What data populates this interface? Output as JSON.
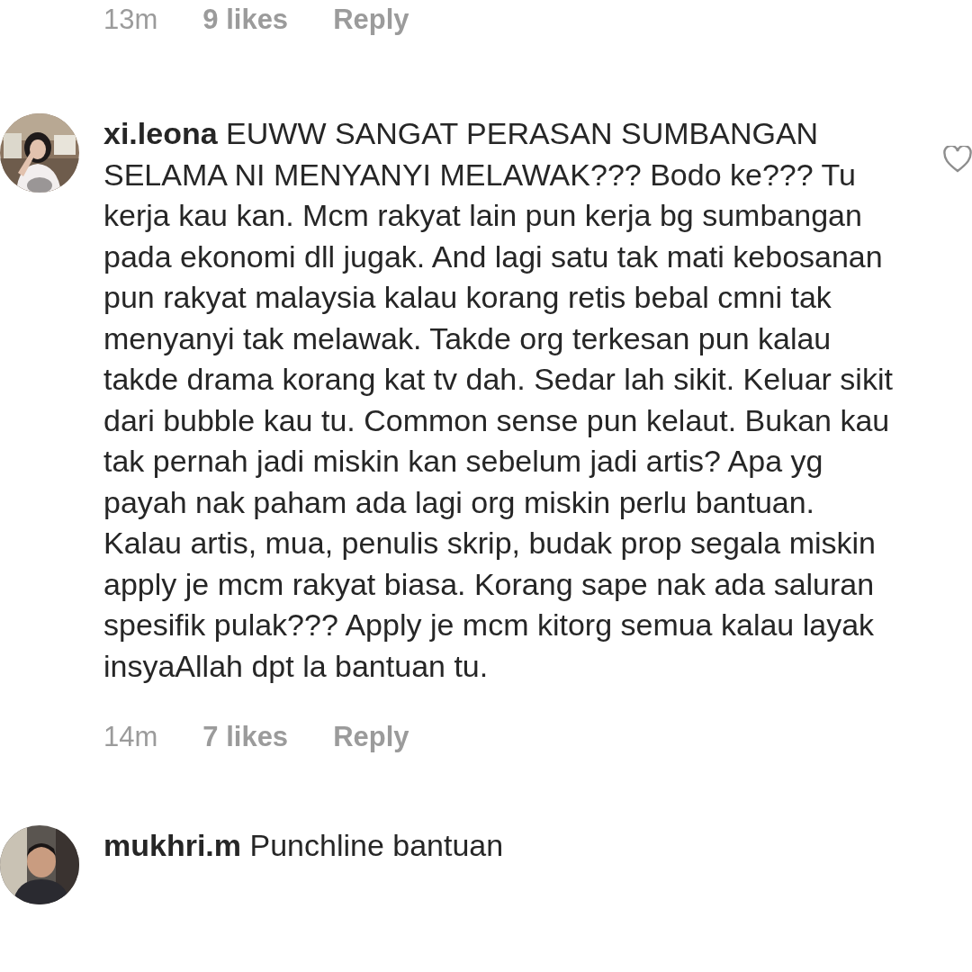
{
  "previous_comment": {
    "time": "13m",
    "likes": "9 likes",
    "reply": "Reply"
  },
  "comments": [
    {
      "username": "xi.leona",
      "text": "EUWW SANGAT PERASAN SUMBANGAN SELAMA NI MENYANYI MELAWAK??? Bodo ke??? Tu kerja kau kan. Mcm rakyat lain pun kerja bg sumbangan pada ekonomi dll jugak. And lagi satu tak mati kebosanan pun rakyat malaysia kalau korang retis bebal cmni tak menyanyi tak melawak. Takde org terkesan pun kalau takde drama korang kat tv dah. Sedar lah sikit. Keluar sikit dari bubble kau tu. Common sense pun kelaut. Bukan kau tak pernah jadi miskin kan sebelum jadi artis? Apa yg payah nak paham ada lagi org miskin perlu bantuan. Kalau artis, mua, penulis skrip, budak prop segala miskin apply je mcm rakyat biasa. Korang sape nak ada saluran spesifik pulak??? Apply je mcm kitorg semua kalau layak insyaAllah dpt la bantuan tu.",
      "liked": false,
      "time": "14m",
      "likes": "7 likes",
      "reply": "Reply"
    },
    {
      "username": "mukhri.m",
      "text": "Punchline bantuan"
    }
  ]
}
